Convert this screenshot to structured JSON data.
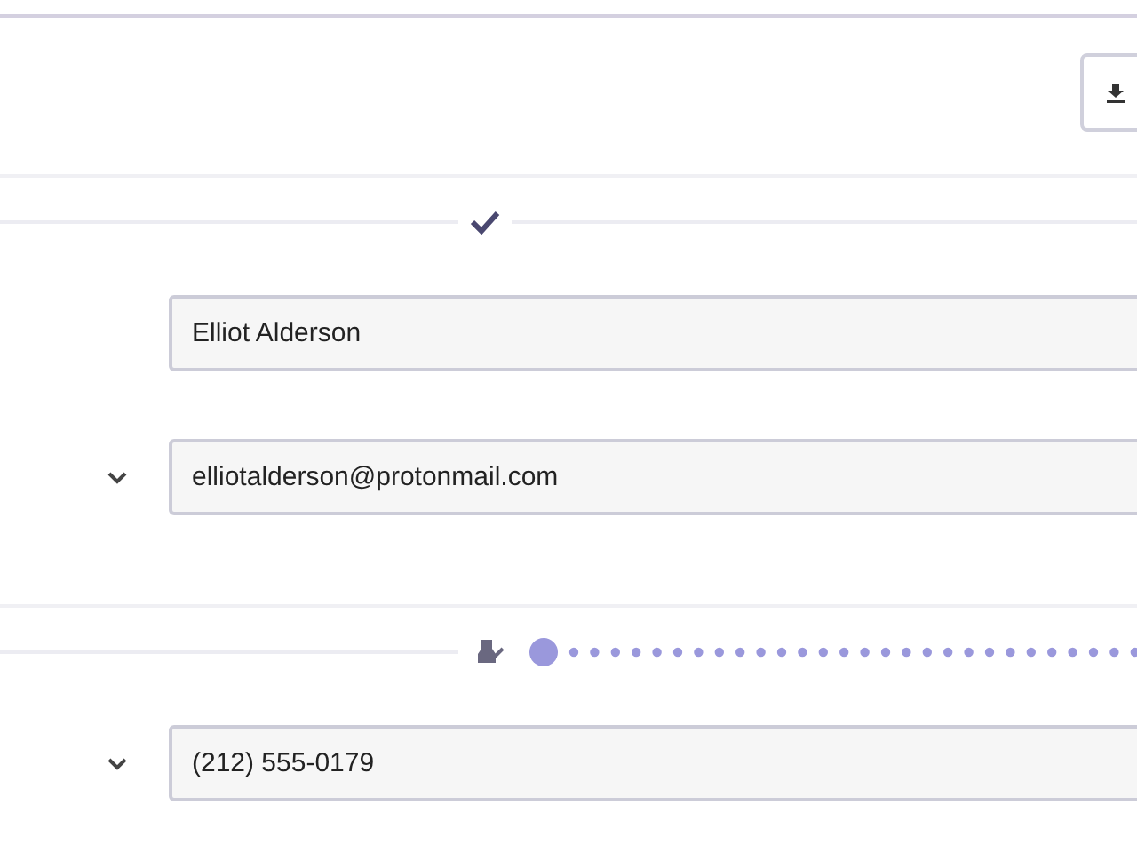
{
  "sections": [
    {
      "kind": "check",
      "fields": [
        {
          "value": "Elliot Alderson",
          "dropdown": false
        },
        {
          "value": "elliotalderson@protonmail.com",
          "dropdown": true
        }
      ]
    },
    {
      "kind": "progress",
      "fields": [
        {
          "value": "(212) 555-0179",
          "dropdown": true
        }
      ]
    }
  ]
}
